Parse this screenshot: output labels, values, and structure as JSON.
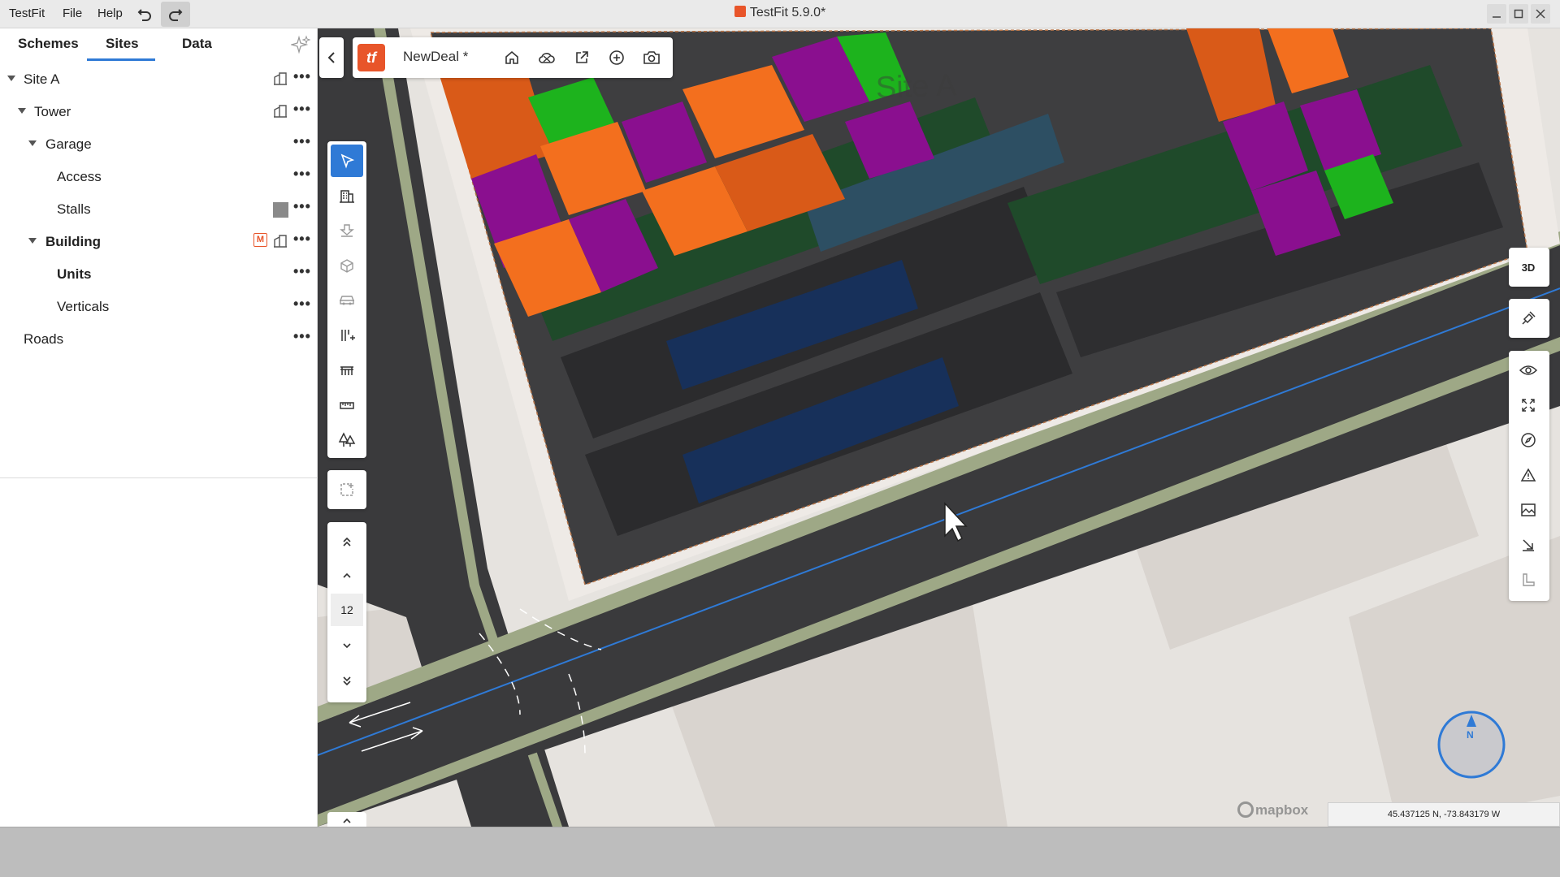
{
  "menu": {
    "app": "TestFit",
    "file": "File",
    "help": "Help"
  },
  "window": {
    "title": "TestFit 5.9.0*"
  },
  "sidebar": {
    "tabs": [
      {
        "label": "Schemes"
      },
      {
        "label": "Sites"
      },
      {
        "label": "Data"
      }
    ],
    "active_tab": "Sites",
    "tree": {
      "site": "Site A",
      "tower": "Tower",
      "garage": "Garage",
      "access": "Access",
      "stalls": "Stalls",
      "building": "Building",
      "units": "Units",
      "verticals": "Verticals",
      "roads": "Roads"
    },
    "badge_m": "M"
  },
  "toolbar": {
    "brand": "tf",
    "project_name": "NewDeal *"
  },
  "palette": {
    "level": "12"
  },
  "right_palette": {
    "mode_3d": "3D"
  },
  "map": {
    "site_label": "Site A",
    "coordinates": "45.437125 N, -73.843179 W",
    "attribution": "mapbox",
    "compass": "N",
    "accent": "#2f7ad6",
    "unit_colors": {
      "orange": "#f36f1e",
      "dark_orange": "#d95a18",
      "purple": "#8a0f8f",
      "green": "#1db31d"
    }
  }
}
